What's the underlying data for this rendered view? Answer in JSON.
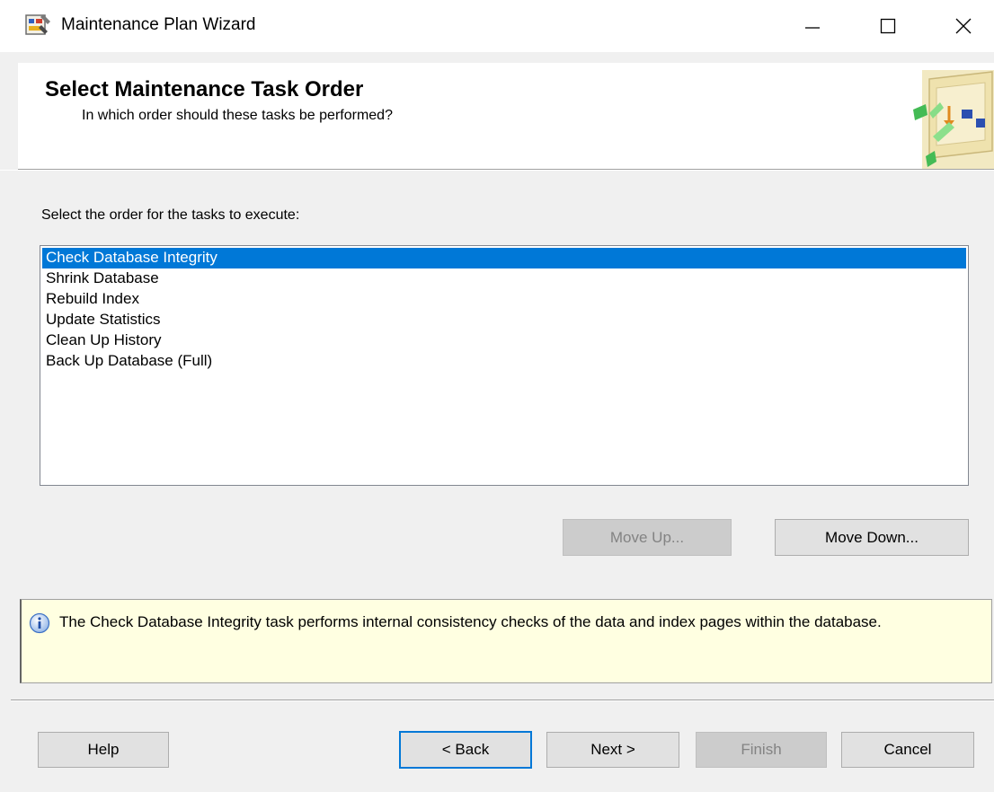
{
  "window": {
    "title": "Maintenance Plan Wizard",
    "app_icon": "maintenance-plan-icon",
    "controls": [
      "minimize-icon",
      "maximize-icon",
      "close-icon"
    ]
  },
  "header": {
    "title": "Select Maintenance Task Order",
    "subtitle": "In which order should these tasks be performed?",
    "graphic": "wizard-flowchart-icon"
  },
  "instruction": "Select the order for the tasks to execute:",
  "tasks": [
    "Check Database Integrity",
    "Shrink Database",
    "Rebuild Index",
    "Update Statistics",
    "Clean Up History",
    "Back Up Database (Full)"
  ],
  "selected_task": "Check Database Integrity",
  "buttons": {
    "move_up": "Move Up...",
    "move_down": "Move Down...",
    "help": "Help",
    "back": "< Back",
    "next": "Next >",
    "finish": "Finish",
    "cancel": "Cancel"
  },
  "description": {
    "icon": "info-icon",
    "text": "The Check Database Integrity task performs internal consistency checks of the data and index pages within the database."
  },
  "colors": {
    "selection": "#0078d7",
    "description_background": "#ffffe1",
    "window_background": "#f0f0f0"
  }
}
